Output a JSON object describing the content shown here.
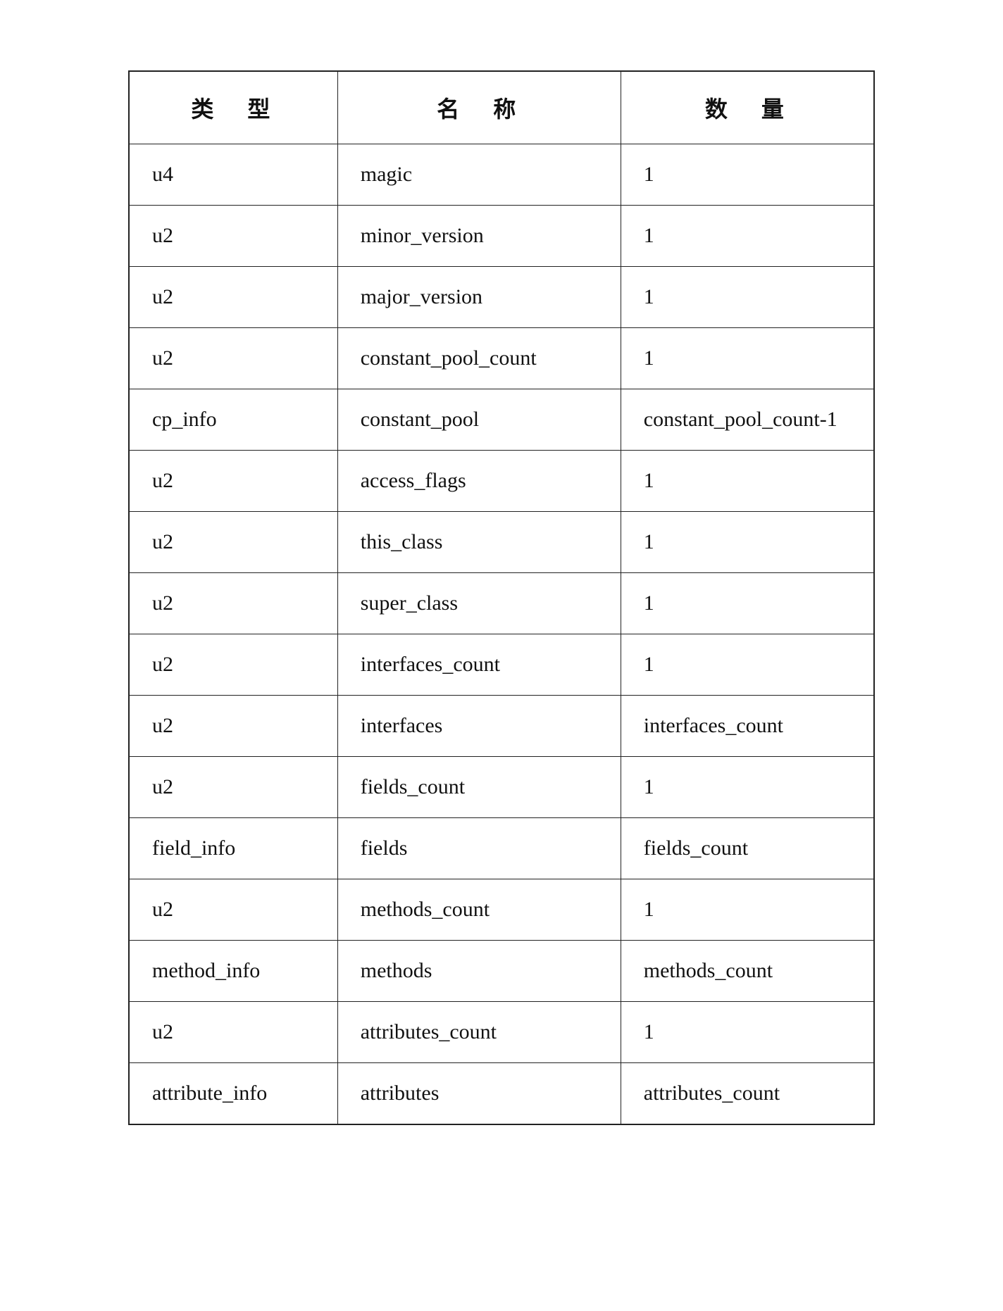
{
  "table": {
    "headers": [
      {
        "label": "类　型"
      },
      {
        "label": "名　称"
      },
      {
        "label": "数　量"
      }
    ],
    "rows": [
      {
        "type": "u4",
        "name": "magic",
        "count": "1"
      },
      {
        "type": "u2",
        "name": "minor_version",
        "count": "1"
      },
      {
        "type": "u2",
        "name": "major_version",
        "count": "1"
      },
      {
        "type": "u2",
        "name": "constant_pool_count",
        "count": "1"
      },
      {
        "type": "cp_info",
        "name": "constant_pool",
        "count": "constant_pool_count-1"
      },
      {
        "type": "u2",
        "name": "access_flags",
        "count": "1"
      },
      {
        "type": "u2",
        "name": "this_class",
        "count": "1"
      },
      {
        "type": "u2",
        "name": "super_class",
        "count": "1"
      },
      {
        "type": "u2",
        "name": "interfaces_count",
        "count": "1"
      },
      {
        "type": "u2",
        "name": "interfaces",
        "count": "interfaces_count"
      },
      {
        "type": "u2",
        "name": "fields_count",
        "count": "1"
      },
      {
        "type": "field_info",
        "name": "fields",
        "count": "fields_count"
      },
      {
        "type": "u2",
        "name": "methods_count",
        "count": "1"
      },
      {
        "type": "method_info",
        "name": "methods",
        "count": "methods_count"
      },
      {
        "type": "u2",
        "name": "attributes_count",
        "count": "1"
      },
      {
        "type": "attribute_info",
        "name": "attributes",
        "count": "attributes_count"
      }
    ]
  }
}
